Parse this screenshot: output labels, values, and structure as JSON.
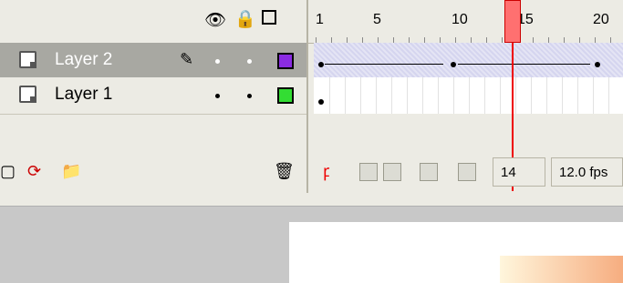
{
  "header": {
    "eye_icon": "eye-icon",
    "lock_icon": "lock-icon",
    "outline_icon": "outline-square-icon"
  },
  "layers": [
    {
      "name": "Layer 2",
      "selected": true,
      "outline_color": "#8a2be2"
    },
    {
      "name": "Layer 1",
      "selected": false,
      "outline_color": "#33dd33"
    }
  ],
  "ruler": {
    "labels": [
      "1",
      "5",
      "10",
      "15",
      "20"
    ]
  },
  "playhead_frame": 14,
  "bottom": {
    "current_frame": "14",
    "frame_rate": "12.0 fps"
  }
}
